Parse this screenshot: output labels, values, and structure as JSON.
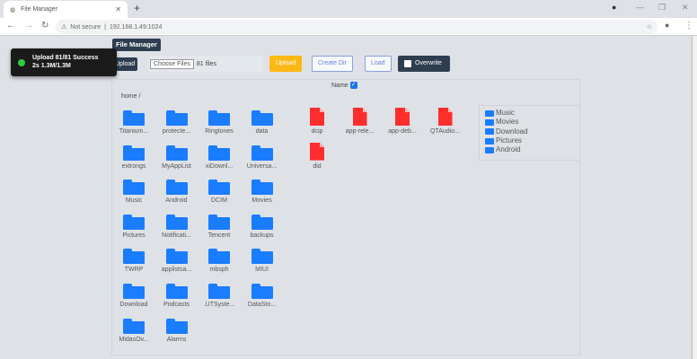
{
  "browser": {
    "tab_title": "File Manager",
    "url_warning": "Not secure",
    "url": "192.168.1.49:1024"
  },
  "app": {
    "title": "File Manager",
    "upload_label": "Upload",
    "choose_files": "Choose Files",
    "files_count": "81 files",
    "upload_button": "Upload",
    "create_dir": "Create Dir",
    "load": "Load",
    "overwrite": "Overwrite",
    "name_column": "Name",
    "breadcrumb": "home /"
  },
  "toast": {
    "line1": "Upload 81/81 Success",
    "line2": "2s 1.3M/1.3M"
  },
  "folders": [
    "Titanium...",
    "protecte...",
    "Ringtones",
    "data",
    "extrongs",
    "MyAppList",
    "xiDownl...",
    "Universa...",
    "Music",
    "Android",
    "DCIM",
    "Movies",
    "Pictures",
    "Notificati...",
    "Tencent",
    "backups",
    "TWRP",
    "applistsa...",
    "mbsph",
    "MIUI",
    "Download",
    "Podcasts",
    ".UTSyste...",
    "DataSto...",
    "MidasOv...",
    "Alarms"
  ],
  "files": [
    "dcip",
    "app-rele...",
    "app-deb...",
    "QTAudio...",
    "did"
  ],
  "quick_access": [
    "Music",
    "Movies",
    "Download",
    "Pictures",
    "Android"
  ]
}
